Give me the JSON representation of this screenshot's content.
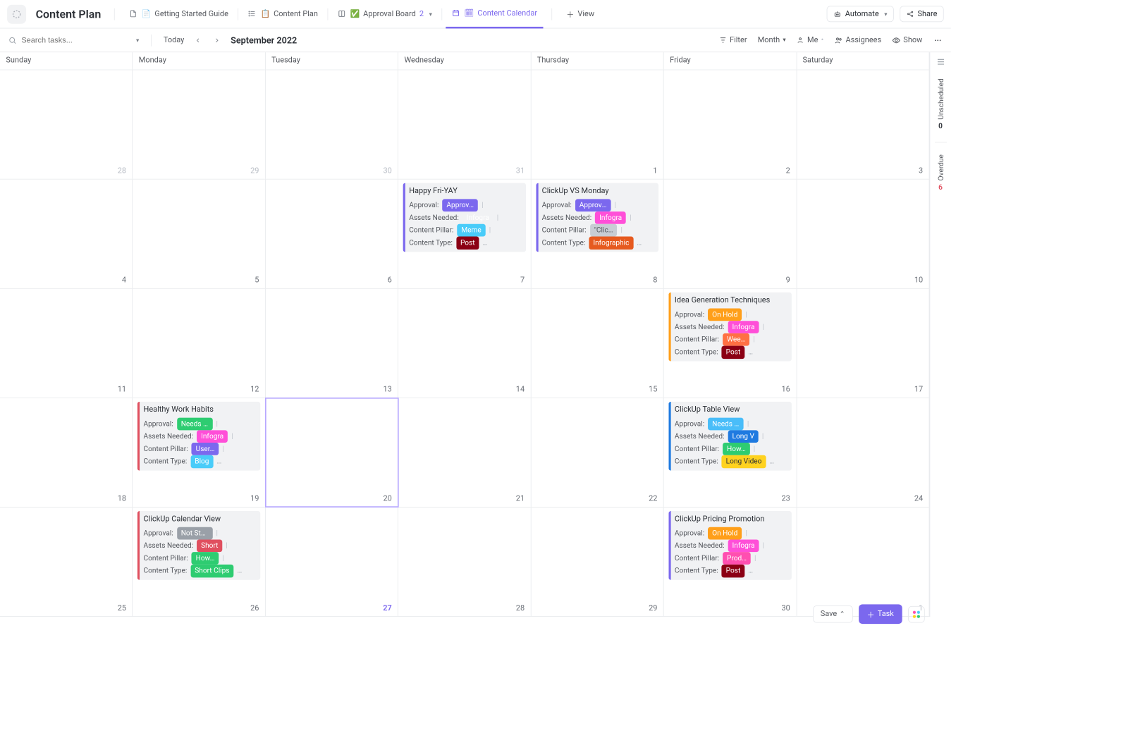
{
  "header": {
    "title": "Content Plan",
    "tabs": [
      {
        "icon": "📄",
        "label": "Getting Started Guide"
      },
      {
        "icon": "📋",
        "label": "Content Plan",
        "listicon": true
      },
      {
        "icon": "✅",
        "label": "Approval Board",
        "badge": "2",
        "bookicon": true
      },
      {
        "icon": "🗓",
        "label": "Content Calendar",
        "active": true,
        "calicon": true
      }
    ],
    "view": "View",
    "automate": "Automate",
    "share": "Share"
  },
  "toolbar": {
    "search_placeholder": "Search tasks...",
    "today": "Today",
    "month_label": "September 2022",
    "filter": "Filter",
    "period": "Month",
    "me": "Me",
    "assignees": "Assignees",
    "show": "Show"
  },
  "dow": [
    "Sunday",
    "Monday",
    "Tuesday",
    "Wednesday",
    "Thursday",
    "Friday",
    "Saturday"
  ],
  "weeks": [
    [
      {
        "n": "28",
        "dim": true
      },
      {
        "n": "29",
        "dim": true
      },
      {
        "n": "30",
        "dim": true
      },
      {
        "n": "31",
        "dim": true
      },
      {
        "n": "1"
      },
      {
        "n": "2"
      },
      {
        "n": "3"
      }
    ],
    [
      {
        "n": "4"
      },
      {
        "n": "5"
      },
      {
        "n": "6"
      },
      {
        "n": "7"
      },
      {
        "n": "8"
      },
      {
        "n": "9"
      },
      {
        "n": "10"
      }
    ],
    [
      {
        "n": "11"
      },
      {
        "n": "12"
      },
      {
        "n": "13"
      },
      {
        "n": "14"
      },
      {
        "n": "15"
      },
      {
        "n": "16"
      },
      {
        "n": "17"
      }
    ],
    [
      {
        "n": "18"
      },
      {
        "n": "19"
      },
      {
        "n": "20",
        "today": true
      },
      {
        "n": "21"
      },
      {
        "n": "22"
      },
      {
        "n": "23"
      },
      {
        "n": "24"
      }
    ],
    [
      {
        "n": "25"
      },
      {
        "n": "26"
      },
      {
        "n": "27",
        "todaynum": true
      },
      {
        "n": "28"
      },
      {
        "n": "29"
      },
      {
        "n": "30"
      },
      {
        "n": "1",
        "dim": true
      }
    ]
  ],
  "field_labels": {
    "approval": "Approval:",
    "assets": "Assets Needed:",
    "pillar": "Content Pillar:",
    "type": "Content Type:"
  },
  "cards": {
    "c_1_3": {
      "bar": "#7b68ee",
      "title": "Happy Fri-YAY",
      "approval": {
        "text": "Approved",
        "bg": "#7b68ee"
      },
      "assets": {
        "text": "Infogra",
        "bg": "#ff4fa"
      },
      "pillar": {
        "text": "Meme",
        "bg": "#49ccf9"
      },
      "type": {
        "text": "Post",
        "bg": "#8b0014"
      }
    },
    "c_1_4": {
      "bar": "#7b68ee",
      "title": "ClickUp VS Monday",
      "approval": {
        "text": "Approved",
        "bg": "#7b68ee"
      },
      "assets": {
        "text": "Infogra",
        "bg": "#ff4fd8"
      },
      "pillar": {
        "text": "\"Clic…",
        "bg": "#c8cdd4",
        "fg": "#54575d"
      },
      "type": {
        "text": "Infographic",
        "bg": "#e65a1f",
        "wide": true
      }
    },
    "c_2_5": {
      "bar": "#ff9f1a",
      "title": "Idea Generation Techniques",
      "approval": {
        "text": "On Hold",
        "bg": "#ff9f1a"
      },
      "assets": {
        "text": "Infogra",
        "bg": "#ff4fd8"
      },
      "pillar": {
        "text": "Wee…",
        "bg": "#ff7043"
      },
      "type": {
        "text": "Post",
        "bg": "#8b0014"
      }
    },
    "c_3_1": {
      "bar": "#e04f5f",
      "title": "Healthy Work Habits",
      "approval": {
        "text": "Needs Re…",
        "bg": "#2ecc71"
      },
      "assets": {
        "text": "Infogra",
        "bg": "#ff4fd8"
      },
      "pillar": {
        "text": "User…",
        "bg": "#7b68ee"
      },
      "type": {
        "text": "Blog",
        "bg": "#49ccf9"
      }
    },
    "c_3_5": {
      "bar": "#1f7ae0",
      "title": "ClickUp Table View",
      "approval": {
        "text": "Needs Up…",
        "bg": "#49bdf9"
      },
      "assets": {
        "text": "Long V",
        "bg": "#1f7ae0"
      },
      "pillar": {
        "text": "How…",
        "bg": "#2ecc71"
      },
      "type": {
        "text": "Long Video",
        "bg": "#ffd21f",
        "fg": "#2a2e34",
        "wide": true
      }
    },
    "c_4_1": {
      "bar": "#e04f5f",
      "title": "ClickUp Calendar View",
      "approval": {
        "text": "Not Started",
        "bg": "#9aa0a8"
      },
      "assets": {
        "text": "Short",
        "bg": "#e04f5f"
      },
      "pillar": {
        "text": "How…",
        "bg": "#2ecc71"
      },
      "type": {
        "text": "Short Clips",
        "bg": "#2ecc71",
        "wide": true
      }
    },
    "c_4_5": {
      "bar": "#7b68ee",
      "title": "ClickUp Pricing Promotion",
      "approval": {
        "text": "On Hold",
        "bg": "#ff9f1a"
      },
      "assets": {
        "text": "Infogra",
        "bg": "#ff4fd8"
      },
      "pillar": {
        "text": "Prod…",
        "bg": "#ff4fb0"
      },
      "type": {
        "text": "Post",
        "bg": "#8b0014"
      }
    }
  },
  "card_placement": {
    "1": {
      "3": "c_1_3",
      "4": "c_1_4"
    },
    "2": {
      "5": "c_2_5"
    },
    "3": {
      "1": "c_3_1",
      "5": "c_3_5"
    },
    "4": {
      "1": "c_4_1",
      "5": "c_4_5"
    }
  },
  "rail": {
    "unscheduled_label": "Unscheduled",
    "unscheduled_count": "0",
    "overdue_label": "Overdue",
    "overdue_count": "6"
  },
  "footer": {
    "save": "Save",
    "task": "Task"
  }
}
